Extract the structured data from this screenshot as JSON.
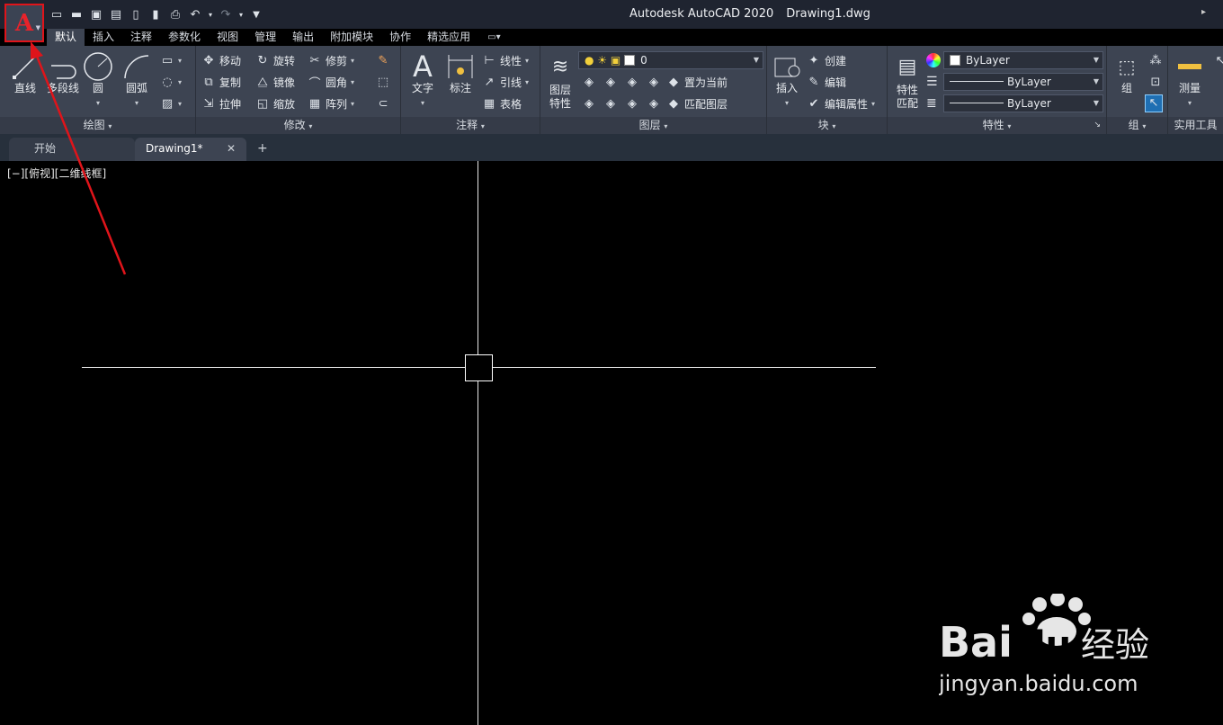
{
  "app": {
    "title": "Autodesk AutoCAD 2020",
    "document": "Drawing1.dwg",
    "app_button_letter": "A",
    "accent_color": "#e0141a"
  },
  "ribbon_tabs": [
    "默认",
    "插入",
    "注释",
    "参数化",
    "视图",
    "管理",
    "输出",
    "附加模块",
    "协作",
    "精选应用"
  ],
  "ribbon": {
    "draw": {
      "title": "绘图",
      "line": "直线",
      "polyline": "多段线",
      "circle": "圆",
      "arc": "圆弧"
    },
    "modify": {
      "title": "修改",
      "move": "移动",
      "rotate": "旋转",
      "trim": "修剪",
      "copy": "复制",
      "mirror": "镜像",
      "fillet": "圆角",
      "stretch": "拉伸",
      "scale": "缩放",
      "array": "阵列"
    },
    "annotation": {
      "title": "注释",
      "text": "文字",
      "dimension": "标注",
      "linear": "线性",
      "leader": "引线",
      "table": "表格"
    },
    "layers": {
      "title": "图层",
      "layer_properties_line1": "图层",
      "layer_properties_line2": "特性",
      "current_layer": "0",
      "set_current": "置为当前",
      "match_layer": "匹配图层"
    },
    "block": {
      "title": "块",
      "insert": "插入",
      "create": "创建",
      "edit": "编辑",
      "edit_attributes": "编辑属性"
    },
    "properties": {
      "title": "特性",
      "match_line1": "特性",
      "match_line2": "匹配",
      "color": "ByLayer",
      "linetype": "ByLayer",
      "lineweight": "ByLayer"
    },
    "groups": {
      "title": "组",
      "group": "组"
    },
    "utilities": {
      "title": "实用工具",
      "measure": "测量"
    }
  },
  "doc_tabs": {
    "start": "开始",
    "drawing": "Drawing1*",
    "new": "+"
  },
  "viewport": {
    "label": "[−][俯视][二维线框]"
  },
  "watermark": {
    "brand": "Baidu 经验",
    "url": "jingyan.baidu.com"
  }
}
